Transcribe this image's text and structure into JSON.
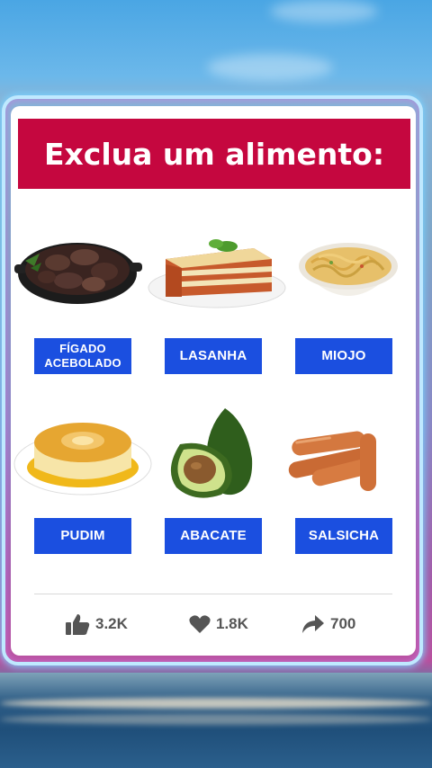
{
  "title": "Exclua um alimento:",
  "foods": [
    {
      "label": "FÍGADO\nACEBOLADO",
      "icon": "liver-onion-dish-icon"
    },
    {
      "label": "LASANHA",
      "icon": "lasagna-icon"
    },
    {
      "label": "MIOJO",
      "icon": "instant-noodles-icon"
    },
    {
      "label": "PUDIM",
      "icon": "flan-pudding-icon"
    },
    {
      "label": "ABACATE",
      "icon": "avocado-icon"
    },
    {
      "label": "SALSICHA",
      "icon": "sausages-icon"
    }
  ],
  "stats": {
    "likes": "3.2K",
    "hearts": "1.8K",
    "shares": "700"
  },
  "colors": {
    "title_bg": "#c5073f",
    "label_bg": "#1b4fe0"
  }
}
